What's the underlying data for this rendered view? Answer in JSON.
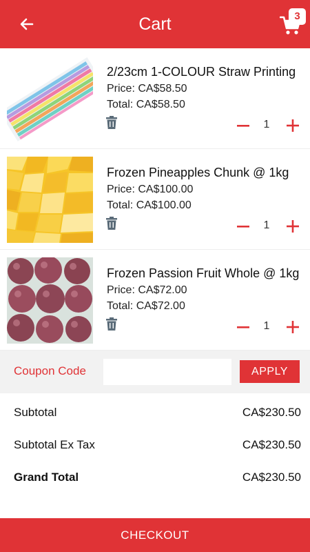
{
  "header": {
    "title": "Cart",
    "cart_count": "3",
    "back_icon": "arrow-left-icon",
    "cart_icon": "shopping-cart-icon"
  },
  "theme": {
    "accent": "#e03336",
    "trash_color": "#5a6b78",
    "coupon_bg": "#f2f2f2"
  },
  "items": [
    {
      "name": "2/23cm 1-COLOUR Straw Printing",
      "price": "Price: CA$58.50",
      "total": "Total: CA$58.50",
      "qty": "1",
      "image": "colored-straws-photo"
    },
    {
      "name": "Frozen Pineapples Chunk @ 1kg",
      "price": "Price: CA$100.00",
      "total": "Total: CA$100.00",
      "qty": "1",
      "image": "pineapple-chunks-photo"
    },
    {
      "name": "Frozen Passion Fruit Whole @ 1kg",
      "price": "Price: CA$72.00",
      "total": "Total: CA$72.00",
      "qty": "1",
      "image": "passion-fruit-photo"
    }
  ],
  "coupon": {
    "label": "Coupon Code",
    "placeholder": "",
    "value": "",
    "apply_label": "APPLY"
  },
  "totals": {
    "subtotal_label": "Subtotal",
    "subtotal_value": "CA$230.50",
    "subtotal_ex_tax_label": "Subtotal Ex Tax",
    "subtotal_ex_tax_value": "CA$230.50",
    "grand_total_label": "Grand Total",
    "grand_total_value": "CA$230.50"
  },
  "checkout_label": "CHECKOUT"
}
